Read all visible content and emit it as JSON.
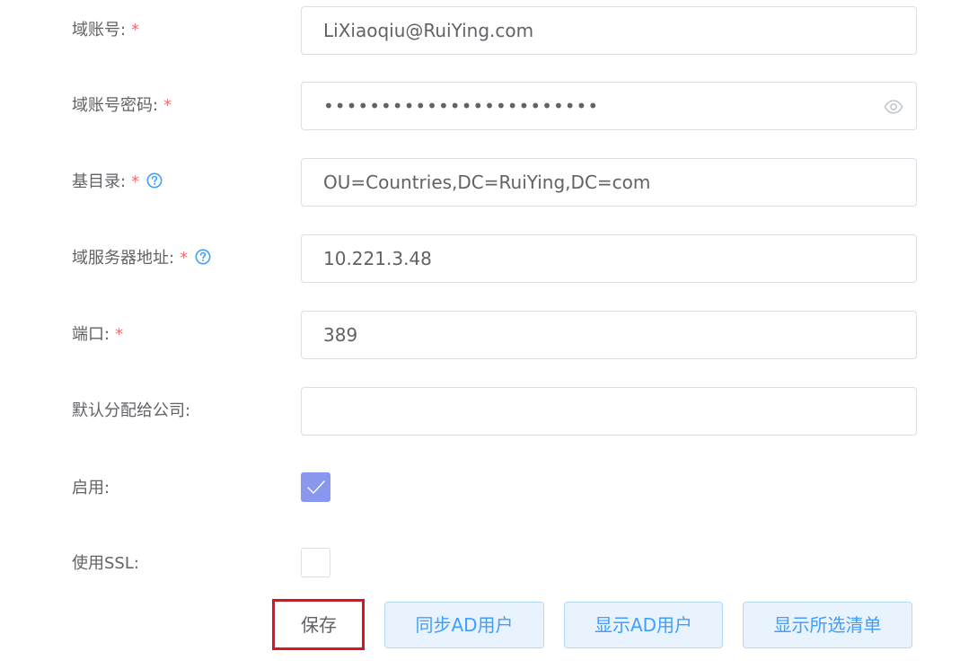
{
  "form": {
    "domain_account": {
      "label": "域账号:",
      "required_mark": "*",
      "value": "LiXiaoqiu@RuiYing.com"
    },
    "domain_password": {
      "label": "域账号密码:",
      "required_mark": "*",
      "value": "••••••••••••••••••••••••",
      "icon": "eye-icon"
    },
    "base_dn": {
      "label": "基目录:",
      "required_mark": "*",
      "help_icon": "question-circle-icon",
      "value": "OU=Countries,DC=RuiYing,DC=com"
    },
    "server_address": {
      "label": "域服务器地址:",
      "required_mark": "*",
      "help_icon": "question-circle-icon",
      "value": "10.221.3.48"
    },
    "port": {
      "label": "端口:",
      "required_mark": "*",
      "value": "389"
    },
    "default_company": {
      "label": "默认分配给公司:",
      "value": ""
    },
    "enabled": {
      "label": "启用:",
      "checked": true
    },
    "use_ssl": {
      "label": "使用SSL:",
      "checked": false
    }
  },
  "actions": {
    "save_label": "保存",
    "sync_label": "同步AD用户",
    "show_label": "显示AD用户",
    "show_selected_label": "显示所选清单"
  },
  "colors": {
    "required": "#f56c6c",
    "help": "#409eff",
    "checkbox_checked": "#8a97ee",
    "highlight": "#e0141e",
    "button_light_bg": "#e8f3fe",
    "button_light_text": "#409eff"
  }
}
